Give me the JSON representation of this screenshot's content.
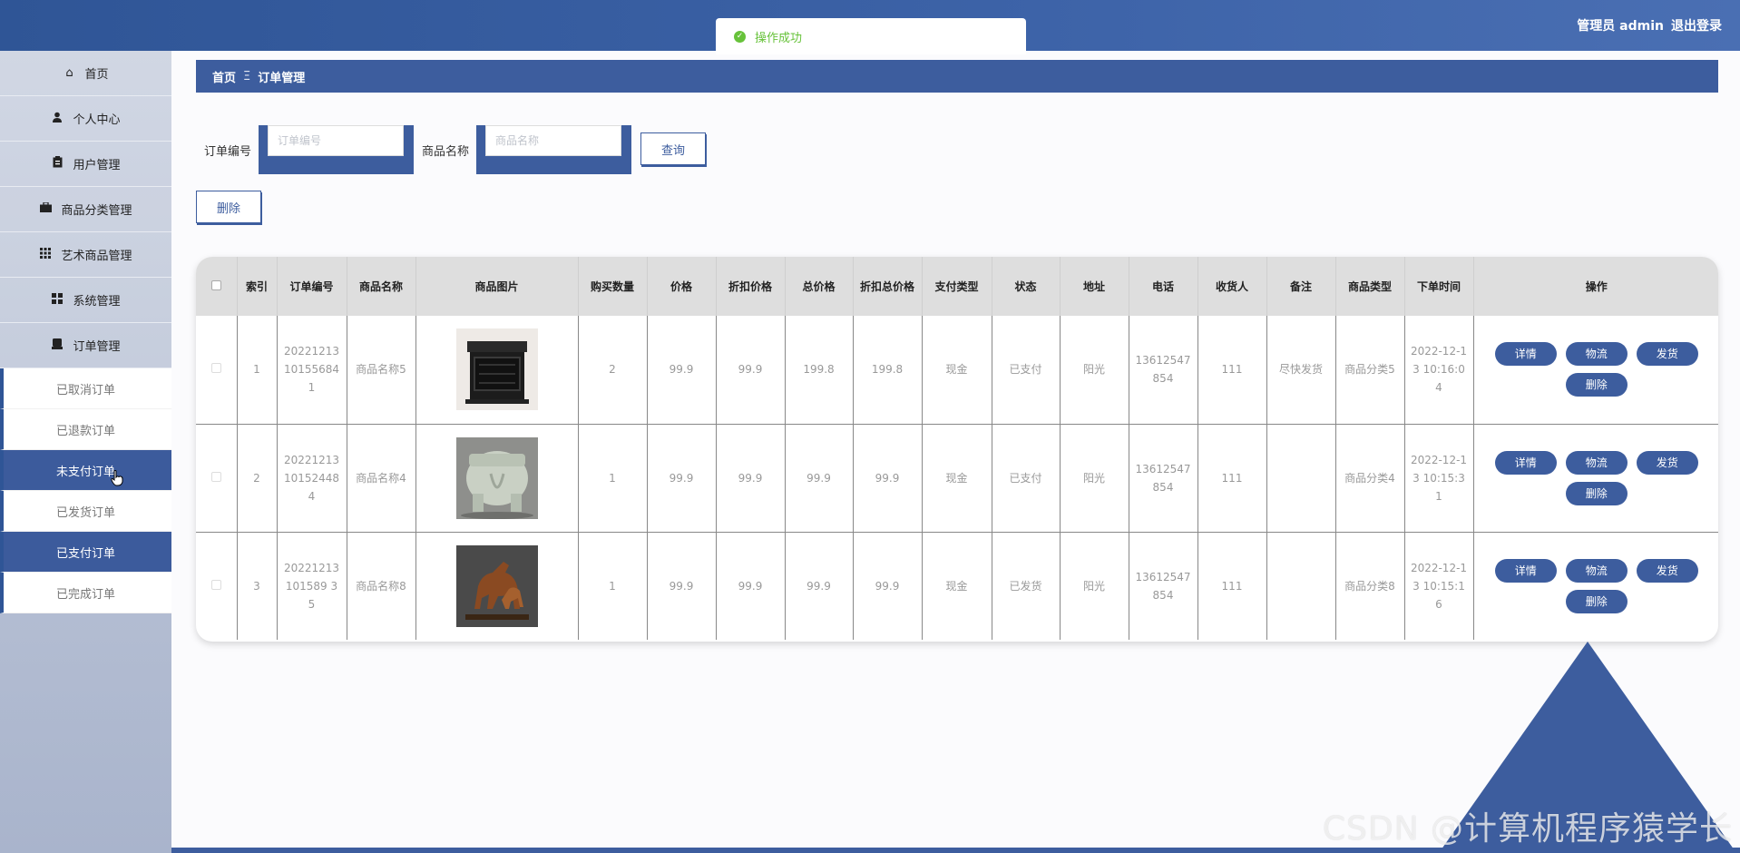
{
  "header": {
    "toast": "操作成功",
    "user_label": "管理员 admin",
    "logout": "退出登录"
  },
  "sidebar": {
    "items": [
      {
        "label": "首页",
        "icon": "home-icon"
      },
      {
        "label": "个人中心",
        "icon": "user-icon"
      },
      {
        "label": "用户管理",
        "icon": "clipboard-icon"
      },
      {
        "label": "商品分类管理",
        "icon": "briefcase-icon"
      },
      {
        "label": "艺术商品管理",
        "icon": "grid-icon"
      },
      {
        "label": "系统管理",
        "icon": "apps-icon"
      },
      {
        "label": "订单管理",
        "icon": "order-icon"
      }
    ],
    "order_submenu": [
      {
        "label": "已取消订单",
        "active": false
      },
      {
        "label": "已退款订单",
        "active": false
      },
      {
        "label": "未支付订单",
        "active": true
      },
      {
        "label": "已发货订单",
        "active": false
      },
      {
        "label": "已支付订单",
        "active": true
      },
      {
        "label": "已完成订单",
        "active": false
      }
    ]
  },
  "breadcrumb": {
    "home": "首页",
    "separator": "Ξ",
    "current": "订单管理"
  },
  "search": {
    "order_no_label": "订单编号",
    "order_no_placeholder": "订单编号",
    "product_label": "商品名称",
    "product_placeholder": "商品名称",
    "query_button": "查询"
  },
  "toolbar": {
    "delete_button": "删除"
  },
  "table": {
    "headers": [
      "索引",
      "订单编号",
      "商品名称",
      "商品图片",
      "购买数量",
      "价格",
      "折扣价格",
      "总价格",
      "折扣总价格",
      "支付类型",
      "状态",
      "地址",
      "电话",
      "收货人",
      "备注",
      "商品类型",
      "下单时间",
      "操作"
    ],
    "op_labels": {
      "detail": "详情",
      "logistics": "物流",
      "ship": "发货",
      "delete": "删除"
    },
    "rows": [
      {
        "index": "1",
        "order_no": "20221213101556841",
        "product_name": "商品名称5",
        "image": "black-carved-box",
        "qty": "2",
        "price": "99.9",
        "discount_price": "99.9",
        "total": "199.8",
        "discount_total": "199.8",
        "pay_type": "现金",
        "status": "已支付",
        "address": "阳光",
        "phone": "13612547854",
        "receiver": "111",
        "remark": "尽快发货",
        "product_type": "商品分类5",
        "order_time": "2022-12-13 10:16:04"
      },
      {
        "index": "2",
        "order_no": "20221213101524484",
        "product_name": "商品名称4",
        "image": "celadon-elephant",
        "qty": "1",
        "price": "99.9",
        "discount_price": "99.9",
        "total": "99.9",
        "discount_total": "99.9",
        "pay_type": "现金",
        "status": "已支付",
        "address": "阳光",
        "phone": "13612547854",
        "receiver": "111",
        "remark": "",
        "product_type": "商品分类4",
        "order_time": "2022-12-13 10:15:31"
      },
      {
        "index": "3",
        "order_no": "20221213101589 35",
        "product_name": "商品名称8",
        "image": "bronze-horse",
        "qty": "1",
        "price": "99.9",
        "discount_price": "99.9",
        "total": "99.9",
        "discount_total": "99.9",
        "pay_type": "现金",
        "status": "已发货",
        "address": "阳光",
        "phone": "13612547854",
        "receiver": "111",
        "remark": "",
        "product_type": "商品分类8",
        "order_time": "2022-12-13 10:15:16"
      }
    ]
  },
  "watermark": "CSDN @计算机程序猿学长",
  "colors": {
    "primary": "#3d5d9e",
    "success": "#67c23a"
  }
}
